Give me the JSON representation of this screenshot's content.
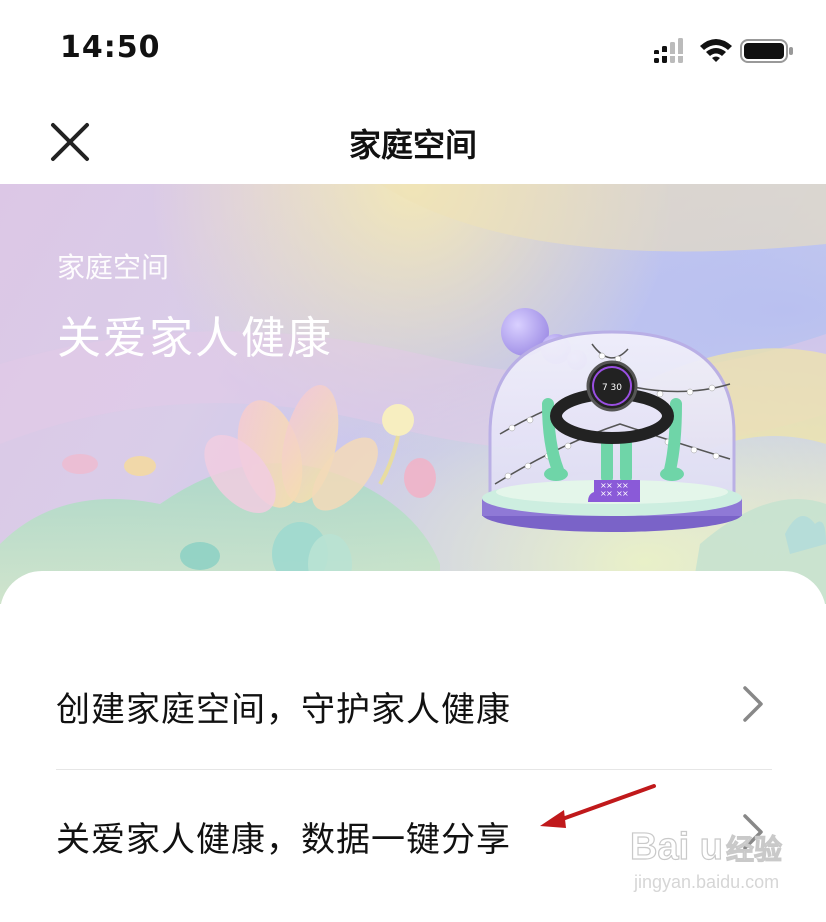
{
  "status_bar": {
    "time": "14:50"
  },
  "nav": {
    "title": "家庭空间"
  },
  "banner": {
    "subtitle": "家庭空间",
    "title": "关爱家人健康",
    "watch_time": "7 30"
  },
  "list": {
    "items": [
      {
        "label": "创建家庭空间，守护家人健康"
      },
      {
        "label": "关爱家人健康，数据一键分享"
      }
    ]
  },
  "watermark": {
    "brand": "Bai  u",
    "brand_cn": "经验",
    "url": "jingyan.baidu.com"
  },
  "colors": {
    "arrow": "#c0191b",
    "text": "#111111",
    "chevron": "#888888"
  }
}
